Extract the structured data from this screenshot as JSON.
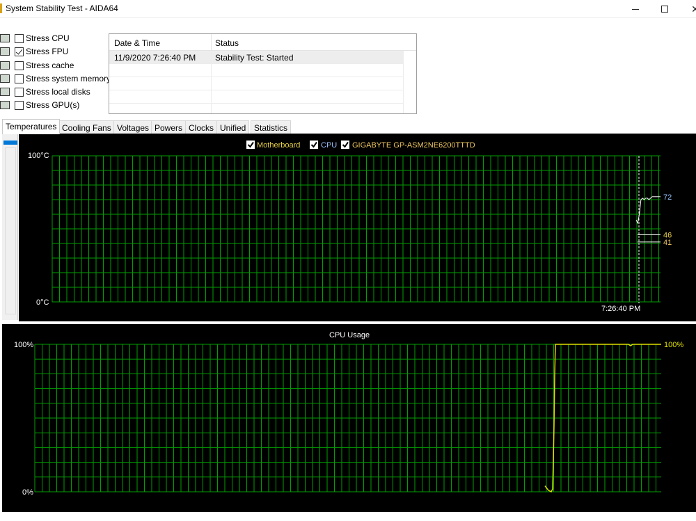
{
  "window": {
    "title": "System Stability Test - AIDA64",
    "minimize_icon": "minimize-icon",
    "maximize_icon": "maximize-icon",
    "close_glyph": "✕"
  },
  "stress_options": [
    {
      "label": "Stress CPU",
      "checked": false,
      "icon": "cpu-icon"
    },
    {
      "label": "Stress FPU",
      "checked": true,
      "icon": "fpu-icon"
    },
    {
      "label": "Stress cache",
      "checked": false,
      "icon": "cache-icon"
    },
    {
      "label": "Stress system memory",
      "checked": false,
      "icon": "memory-icon"
    },
    {
      "label": "Stress local disks",
      "checked": false,
      "icon": "disk-icon"
    },
    {
      "label": "Stress GPU(s)",
      "checked": false,
      "icon": "gpu-icon"
    }
  ],
  "status_table": {
    "headers": [
      "Date & Time",
      "Status"
    ],
    "rows": [
      {
        "datetime": "11/9/2020 7:26:40 PM",
        "status": "Stability Test: Started"
      }
    ]
  },
  "tabs": [
    "Temperatures",
    "Cooling Fans",
    "Voltages",
    "Powers",
    "Clocks",
    "Unified",
    "Statistics"
  ],
  "active_tab": "Temperatures",
  "colors": {
    "grid": "#00a000",
    "motherboard": "#e8d048",
    "cpu": "#9bc4ff",
    "gigabyte": "#f0c860",
    "cpu_usage": "#e0e000",
    "marker": "#ffffff"
  },
  "chart_data": [
    {
      "type": "line",
      "legend": [
        {
          "name": "Motherboard",
          "checked": true,
          "color": "#e8d048"
        },
        {
          "name": "CPU",
          "checked": true,
          "color": "#9bc4ff"
        },
        {
          "name": "GIGABYTE GP-ASM2NE6200TTTD",
          "checked": true,
          "color": "#f0c860"
        }
      ],
      "ymax_label": "100°C",
      "ymin_label": "0°C",
      "ylim": [
        0,
        100
      ],
      "time_label": "7:26:40 PM",
      "grid": true,
      "series": [
        {
          "name": "CPU",
          "values": [
            56,
            54,
            60,
            70,
            71,
            70,
            71,
            71,
            70,
            71,
            72
          ],
          "last": "72"
        },
        {
          "name": "Motherboard",
          "values": [
            46
          ],
          "last": "46"
        },
        {
          "name": "GIGABYTE GP-ASM2NE6200TTTD",
          "values": [
            41
          ],
          "last": "41"
        }
      ]
    },
    {
      "type": "line",
      "title": "CPU Usage",
      "ymax_label": "100%",
      "ymin_label": "0%",
      "ylim": [
        0,
        100
      ],
      "grid": true,
      "series": [
        {
          "name": "CPU Usage",
          "values": [
            4,
            1,
            0,
            2,
            20,
            45,
            80,
            100,
            100,
            100,
            100,
            100,
            99,
            100,
            100
          ],
          "last": "100%"
        }
      ]
    }
  ]
}
